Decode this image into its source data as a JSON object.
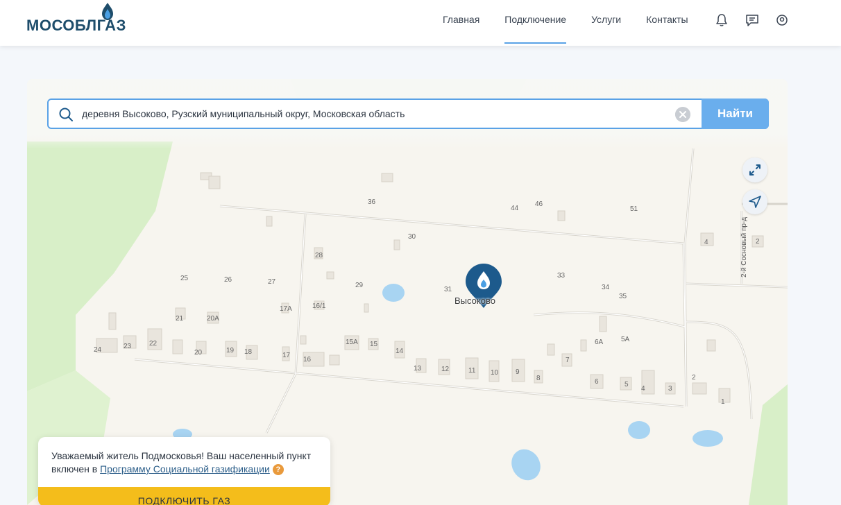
{
  "header": {
    "logo_text": "МОСОБЛГАЗ",
    "nav": [
      "Главная",
      "Подключение",
      "Услуги",
      "Контакты"
    ],
    "active_nav": "Подключение",
    "icons": [
      "bell-icon",
      "chat-icon",
      "user-icon"
    ]
  },
  "search": {
    "value": "деревня Высоково, Рузский муниципальный округ, Московская область",
    "button_label": "Найти"
  },
  "map": {
    "place_label": "Высоково",
    "street_label": "2-й Сосновый пр-д",
    "house_numbers": [
      "36",
      "44",
      "46",
      "51",
      "30",
      "28",
      "4",
      "2",
      "25",
      "26",
      "27",
      "29",
      "31",
      "33",
      "34",
      "35",
      "21",
      "20А",
      "17А",
      "16/1",
      "24",
      "23",
      "22",
      "20",
      "19",
      "18",
      "17",
      "16",
      "15А",
      "15",
      "14",
      "13",
      "12",
      "11",
      "10",
      "9",
      "8",
      "7",
      "6А",
      "5А",
      "6",
      "5",
      "4",
      "3",
      "2",
      "1"
    ],
    "controls": [
      "expand-icon",
      "locate-icon"
    ]
  },
  "notice": {
    "text_before": "Уважаемый житель Подмосковья! Ваш населенный пункт включен в ",
    "link": "Программу Социальной газификации",
    "help_badge": "?",
    "button_label": "ПОДКЛЮЧИТЬ ГАЗ"
  },
  "colors": {
    "brand": "#1e4d6b",
    "accent": "#5aa2e6",
    "button": "#6aaeed",
    "cta": "#f4bd1b",
    "pin": "#1d5a8c"
  }
}
